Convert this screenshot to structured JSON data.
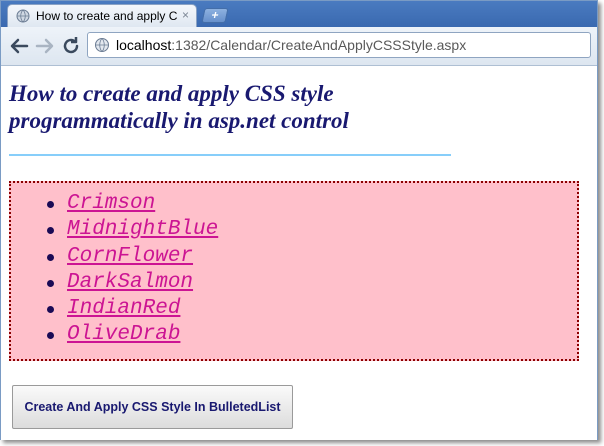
{
  "browser": {
    "tab_title": "How to create and apply CSS",
    "tab_close": "×",
    "new_tab": "+",
    "url_host": "localhost",
    "url_rest": ":1382/Calendar/CreateAndApplyCSSStyle.aspx"
  },
  "page": {
    "heading_line1": "How to create and apply CSS style",
    "heading_line2": "programmatically in asp.net control",
    "items": [
      {
        "label": "Crimson"
      },
      {
        "label": "MidnightBlue"
      },
      {
        "label": "CornFlower"
      },
      {
        "label": "DarkSalmon"
      },
      {
        "label": "IndianRed"
      },
      {
        "label": "OliveDrab"
      }
    ],
    "button_label": "Create And Apply CSS Style In BulletedList"
  },
  "icons": [
    "globe-favicon-icon",
    "back-arrow-icon",
    "forward-arrow-icon",
    "reload-icon",
    "page-icon",
    "close-icon",
    "new-tab-icon"
  ],
  "colors": {
    "heading": "#191970",
    "rule": "#87cefa",
    "list_background": "#ffc0cb",
    "list_border": "#8b0000",
    "list_text": "#c71585"
  }
}
